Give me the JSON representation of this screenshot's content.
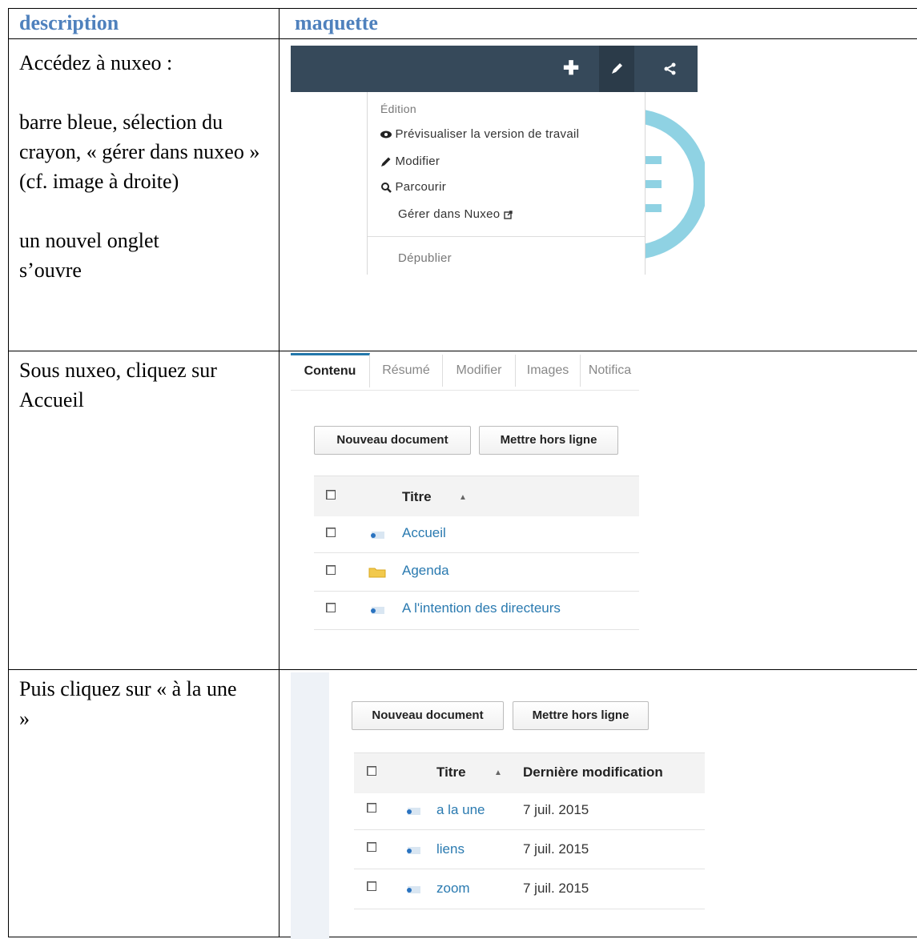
{
  "headers": {
    "description": "description",
    "maquette": "maquette"
  },
  "rows": [
    {
      "desc_paragraphs": [
        "Accédez  à  nuxeo :",
        "barre bleue, sélection du crayon, « gérer dans nuxeo » (cf. image à droite)",
        "un nouvel onglet s’ouvre"
      ]
    },
    {
      "desc_paragraphs": [
        "Sous nuxeo, cliquez sur Accueil"
      ]
    },
    {
      "desc_paragraphs": [
        "Puis cliquez sur « à la une »"
      ]
    }
  ],
  "mockup1": {
    "toolbar_buttons": [
      {
        "icon": "plus-icon",
        "glyph": "✚"
      },
      {
        "icon": "pencil-icon",
        "glyph": "✎"
      },
      {
        "icon": "share-icon",
        "glyph": "<"
      }
    ],
    "menu": {
      "section_label": "Édition",
      "items": [
        {
          "icon": "eye-icon",
          "glyph": "👁",
          "label": "Prévisualiser la version de travail"
        },
        {
          "icon": "pencil-icon",
          "glyph": "✎",
          "label": "Modifier"
        },
        {
          "icon": "search-icon",
          "glyph": "🔍",
          "label": "Parcourir"
        },
        {
          "icon": "",
          "glyph": "",
          "label": "Gérer dans Nuxeo"
        }
      ],
      "external_link_icon": "external-link-icon",
      "external_glyph": "⧉",
      "footer_item": "Dépublier"
    }
  },
  "mockup2": {
    "tabs": [
      "Contenu",
      "Résumé",
      "Modifier",
      "Images",
      "Notifica"
    ],
    "buttons": [
      "Nouveau document",
      "Mettre hors ligne"
    ],
    "column_title": "Titre",
    "rows": [
      {
        "title": "Accueil",
        "icon": "document-icon"
      },
      {
        "title": "Agenda",
        "icon": "folder-icon"
      },
      {
        "title": "A l'intention des directeurs",
        "icon": "document-icon"
      }
    ]
  },
  "mockup3": {
    "buttons": [
      "Nouveau document",
      "Mettre hors ligne"
    ],
    "column_title": "Titre",
    "column_modified": "Dernière modification",
    "rows": [
      {
        "title": "a la une",
        "date": "7 juil. 2015"
      },
      {
        "title": "liens",
        "date": "7 juil. 2015"
      },
      {
        "title": "zoom",
        "date": "7 juil. 2015"
      }
    ]
  },
  "colors": {
    "header_blue": "#4f81bd",
    "toolbar": "#36495a",
    "link": "#2a7ab0"
  }
}
